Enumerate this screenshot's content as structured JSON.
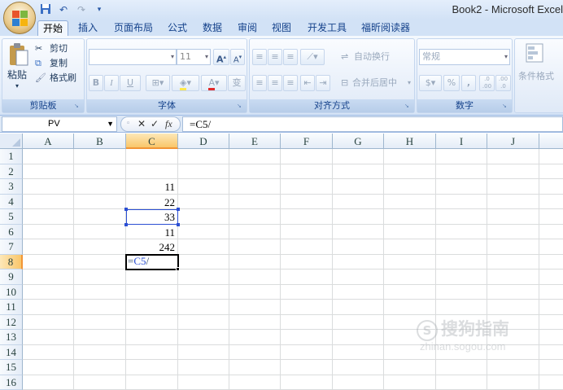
{
  "window": {
    "title": "Book2 - Microsoft Excel"
  },
  "qat": {
    "save_icon": "save-icon",
    "undo_icon": "undo-icon",
    "redo_icon": "redo-icon"
  },
  "tabs": [
    {
      "label": "开始",
      "active": true
    },
    {
      "label": "插入"
    },
    {
      "label": "页面布局"
    },
    {
      "label": "公式"
    },
    {
      "label": "数据"
    },
    {
      "label": "审阅"
    },
    {
      "label": "视图"
    },
    {
      "label": "开发工具"
    },
    {
      "label": "福昕阅读器"
    }
  ],
  "ribbon": {
    "clipboard": {
      "label": "剪贴板",
      "paste": "粘贴",
      "cut": "剪切",
      "copy": "复制",
      "format_painter": "格式刷"
    },
    "font": {
      "label": "字体",
      "font_name": "",
      "font_size": "11",
      "bold": "B",
      "italic": "I",
      "underline": "U",
      "grow": "A",
      "shrink": "A",
      "phonetic": "变"
    },
    "alignment": {
      "label": "对齐方式",
      "wrap_text": "自动换行",
      "merge_center": "合并后居中"
    },
    "number": {
      "label": "数字",
      "format": "常规",
      "percent": "%",
      "comma": ",",
      "inc_decimal": ".0 .00",
      "dec_decimal": ".00 .0"
    },
    "styles": {
      "conditional_format": "条件格式"
    }
  },
  "formula_bar": {
    "name_box": "PV",
    "cancel": "✕",
    "enter": "✓",
    "fx": "fx",
    "formula": "=C5/"
  },
  "sheet": {
    "columns": [
      "A",
      "B",
      "C",
      "D",
      "E",
      "F",
      "G",
      "H",
      "I",
      "J"
    ],
    "selected_column": "C",
    "rows": [
      "1",
      "2",
      "3",
      "4",
      "5",
      "6",
      "7",
      "8",
      "9",
      "10",
      "11",
      "12",
      "13",
      "14",
      "15",
      "16"
    ],
    "selected_row": "8",
    "cells": {
      "C3": "11",
      "C4": "22",
      "C5": "33",
      "C6": "11",
      "C7": "242"
    },
    "editing_cell": {
      "ref": "C8",
      "text_eq": "=",
      "text_ref": "C5",
      "text_rest": "/"
    }
  },
  "watermark": {
    "line1": "搜狗指南",
    "line2": "zhinan.sogou.com"
  }
}
